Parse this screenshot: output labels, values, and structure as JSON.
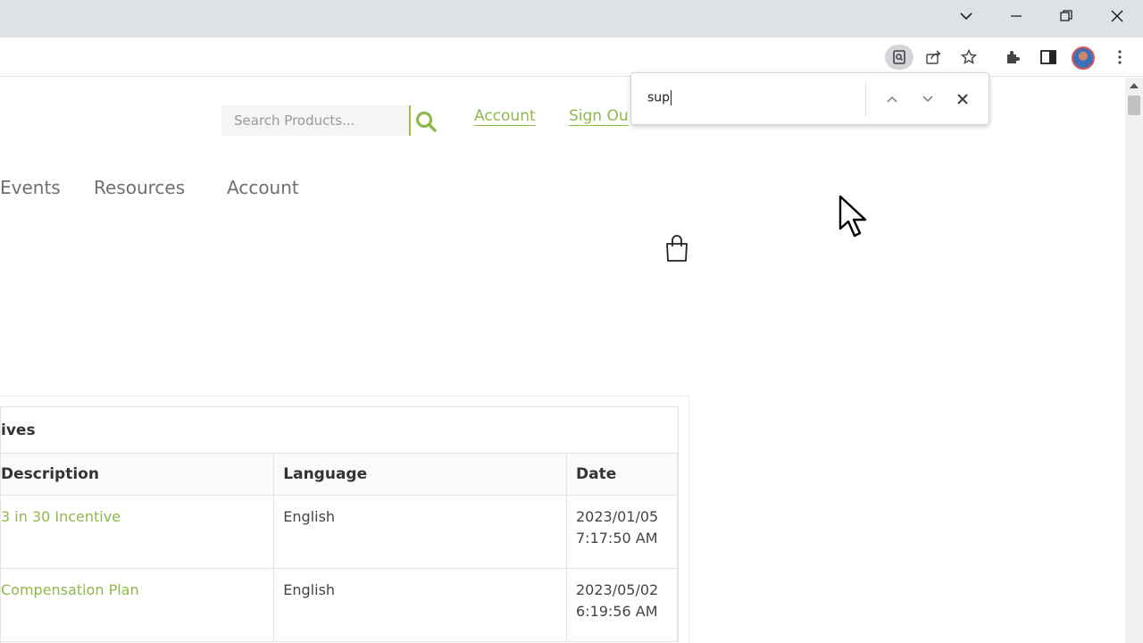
{
  "browser": {
    "window_controls": {
      "tab_search": "chevron-down",
      "minimize": "minimize",
      "restore": "restore",
      "close": "close"
    },
    "toolbar_icons": [
      "find-in-page",
      "share",
      "bookmark-star",
      "extensions",
      "side-panel",
      "profile",
      "menu"
    ]
  },
  "find_bar": {
    "query": "sup"
  },
  "site": {
    "search_placeholder": "Search Products...",
    "account_link": "Account",
    "signout_link": "Sign Ou",
    "nav": [
      "Events",
      "Resources",
      "Account"
    ]
  },
  "panel": {
    "title": "ives",
    "columns": [
      "Description",
      "Language",
      "Date"
    ],
    "rows": [
      {
        "description": "3 in 30 Incentive",
        "language": "English",
        "date_line1": "2023/01/05",
        "date_line2": "7:17:50 AM"
      },
      {
        "description": "Compensation Plan",
        "language": "English",
        "date_line1": "2023/05/02",
        "date_line2": "6:19:56 AM"
      }
    ]
  },
  "colors": {
    "accent_green": "#8fb84a",
    "chrome_titlebar": "#dee1e6"
  }
}
